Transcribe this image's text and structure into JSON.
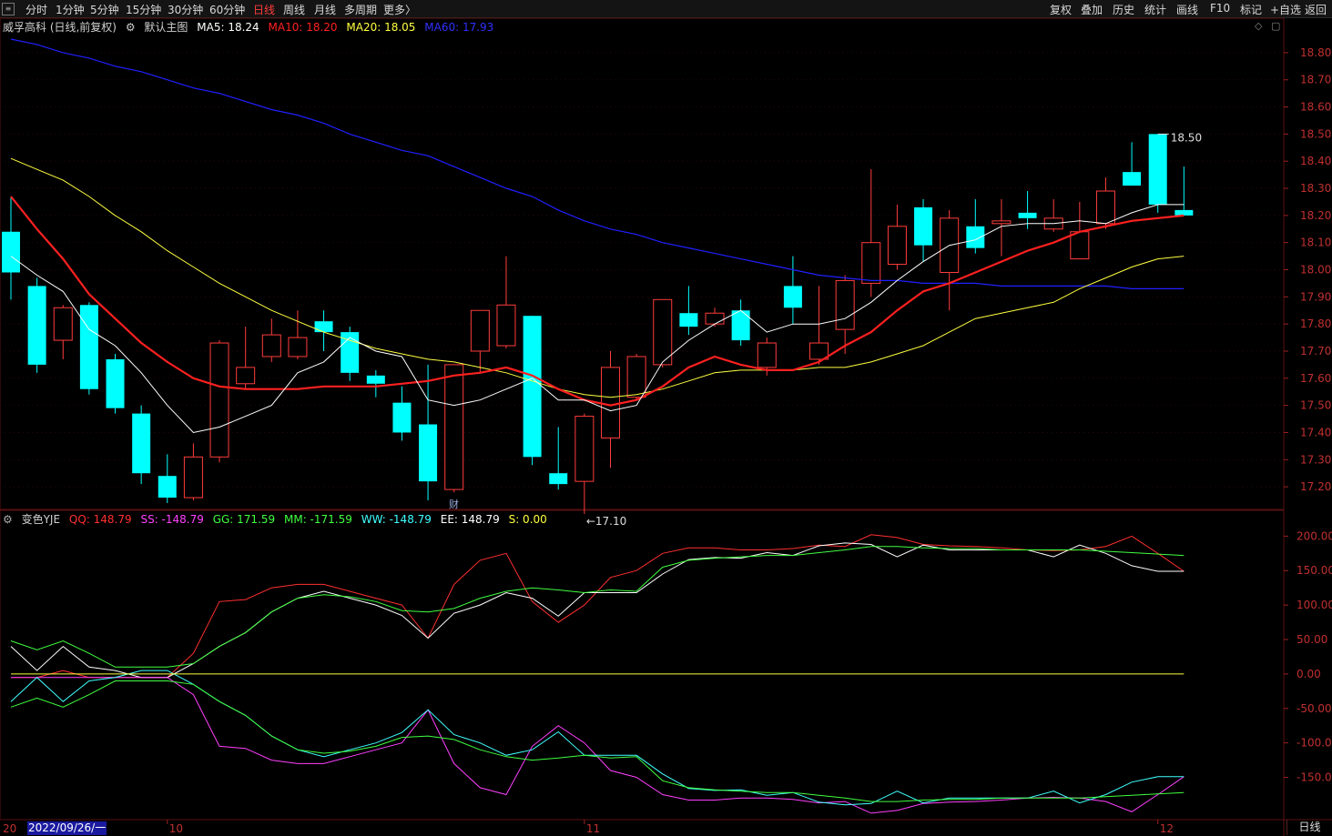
{
  "toolbar": {
    "menu_icon": "menu-icon",
    "periods": [
      "分时",
      "1分钟",
      "5分钟",
      "15分钟",
      "30分钟",
      "60分钟",
      "日线",
      "周线",
      "月线",
      "多周期",
      "更多〉"
    ],
    "active_period": "日线",
    "right_buttons": [
      "复权",
      "叠加",
      "历史",
      "统计",
      "画线",
      "F10",
      "标记",
      "+自选",
      "返回"
    ]
  },
  "main_chart": {
    "stock_name": "威孚高科 (日线,前复权)",
    "template": "默认主图",
    "ma_indicators": [
      {
        "label": "MA5: 18.24",
        "color": "#ffffff"
      },
      {
        "label": "MA10: 18.20",
        "color": "#ff2020"
      },
      {
        "label": "MA20: 18.05",
        "color": "#ffff40"
      },
      {
        "label": "MA60: 17.93",
        "color": "#2020ff"
      }
    ],
    "price_ticks": [
      "18.80",
      "18.70",
      "18.60",
      "18.50",
      "18.40",
      "18.30",
      "18.20",
      "18.10",
      "18.00",
      "17.90",
      "17.80",
      "17.70",
      "17.60",
      "17.50",
      "17.40",
      "17.30",
      "17.20"
    ],
    "high_annotation": "18.50",
    "low_annotation": "←17.10",
    "finance_mark": "财"
  },
  "sub_chart": {
    "indicator_name": "变色YJE",
    "values": [
      {
        "label": "QQ: 148.79",
        "color": "#ff3030"
      },
      {
        "label": "SS: -148.79",
        "color": "#ff40ff"
      },
      {
        "label": "GG: 171.59",
        "color": "#40ff40"
      },
      {
        "label": "MM: -171.59",
        "color": "#40ff40"
      },
      {
        "label": "WW: -148.79",
        "color": "#40ffff"
      },
      {
        "label": "EE: 148.79",
        "color": "#ffffff"
      },
      {
        "label": "S: 0.00",
        "color": "#ffff40"
      }
    ],
    "ticks": [
      "200.00",
      "150.00",
      "100.00",
      "50.00",
      "0.00",
      "-50.00",
      "-100.00",
      "-150.00"
    ]
  },
  "x_axis": {
    "first_label": "20",
    "cursor_date": "2022/09/26/一",
    "month_labels": [
      {
        "idx": 6,
        "label": "10"
      },
      {
        "idx": 22,
        "label": "11"
      },
      {
        "idx": 44,
        "label": "12"
      }
    ]
  },
  "period_label": "日线",
  "colors": {
    "up": "#ff3c3c",
    "down": "#00ffff",
    "ma5": "#ffffff",
    "ma10": "#ff2020",
    "ma20": "#ffff40",
    "ma60": "#2020ff",
    "grid": "#5a1010"
  },
  "chart_data": {
    "type": "candlestick",
    "ohlc": [
      [
        18.14,
        18.27,
        17.89,
        17.99
      ],
      [
        17.94,
        17.97,
        17.62,
        17.65
      ],
      [
        17.74,
        17.87,
        17.67,
        17.86
      ],
      [
        17.87,
        17.88,
        17.54,
        17.56
      ],
      [
        17.67,
        17.69,
        17.47,
        17.49
      ],
      [
        17.47,
        17.5,
        17.21,
        17.25
      ],
      [
        17.24,
        17.32,
        17.14,
        17.16
      ],
      [
        17.16,
        17.36,
        17.15,
        17.31
      ],
      [
        17.31,
        17.74,
        17.29,
        17.73
      ],
      [
        17.58,
        17.79,
        17.56,
        17.64
      ],
      [
        17.68,
        17.82,
        17.66,
        17.76
      ],
      [
        17.68,
        17.85,
        17.67,
        17.75
      ],
      [
        17.81,
        17.85,
        17.7,
        17.77
      ],
      [
        17.77,
        17.79,
        17.59,
        17.62
      ],
      [
        17.61,
        17.63,
        17.53,
        17.58
      ],
      [
        17.51,
        17.57,
        17.37,
        17.4
      ],
      [
        17.43,
        17.65,
        17.15,
        17.22
      ],
      [
        17.19,
        17.65,
        17.18,
        17.65
      ],
      [
        17.7,
        17.84,
        17.62,
        17.85
      ],
      [
        17.72,
        18.05,
        17.71,
        17.87
      ],
      [
        17.83,
        17.83,
        17.28,
        17.31
      ],
      [
        17.25,
        17.42,
        17.19,
        17.21
      ],
      [
        17.22,
        17.47,
        17.1,
        17.46
      ],
      [
        17.38,
        17.7,
        17.27,
        17.64
      ],
      [
        17.53,
        17.69,
        17.52,
        17.68
      ],
      [
        17.65,
        17.88,
        17.64,
        17.89
      ],
      [
        17.84,
        17.94,
        17.76,
        17.79
      ],
      [
        17.8,
        17.86,
        17.79,
        17.84
      ],
      [
        17.85,
        17.89,
        17.72,
        17.74
      ],
      [
        17.64,
        17.75,
        17.61,
        17.73
      ],
      [
        17.94,
        18.05,
        17.8,
        17.86
      ],
      [
        17.67,
        17.94,
        17.65,
        17.73
      ],
      [
        17.78,
        17.98,
        17.69,
        17.96
      ],
      [
        17.95,
        18.37,
        17.9,
        18.1
      ],
      [
        18.02,
        18.24,
        18.0,
        18.16
      ],
      [
        18.23,
        18.26,
        18.03,
        18.09
      ],
      [
        17.99,
        18.22,
        17.85,
        18.19
      ],
      [
        18.16,
        18.26,
        18.06,
        18.08
      ],
      [
        18.17,
        18.26,
        18.05,
        18.18
      ],
      [
        18.21,
        18.29,
        18.15,
        18.19
      ],
      [
        18.15,
        18.26,
        18.14,
        18.19
      ],
      [
        18.04,
        18.25,
        18.13,
        18.14
      ],
      [
        18.17,
        18.34,
        18.15,
        18.29
      ],
      [
        18.36,
        18.47,
        18.33,
        18.31
      ],
      [
        18.5,
        18.5,
        18.21,
        18.24
      ],
      [
        18.22,
        18.38,
        18.2,
        18.2
      ]
    ],
    "ma5": [
      18.05,
      17.98,
      17.92,
      17.78,
      17.72,
      17.62,
      17.5,
      17.4,
      17.42,
      17.46,
      17.5,
      17.62,
      17.66,
      17.75,
      17.7,
      17.68,
      17.52,
      17.5,
      17.52,
      17.56,
      17.6,
      17.52,
      17.52,
      17.48,
      17.5,
      17.66,
      17.74,
      17.8,
      17.85,
      17.77,
      17.8,
      17.8,
      17.82,
      17.88,
      17.96,
      18.03,
      18.09,
      18.11,
      18.16,
      18.17,
      18.17,
      18.18,
      18.17,
      18.21,
      18.24,
      18.24
    ],
    "ma10": [
      18.27,
      18.15,
      18.04,
      17.91,
      17.82,
      17.73,
      17.66,
      17.6,
      17.57,
      17.56,
      17.56,
      17.56,
      17.57,
      17.57,
      17.57,
      17.58,
      17.59,
      17.61,
      17.62,
      17.64,
      17.61,
      17.56,
      17.52,
      17.5,
      17.52,
      17.57,
      17.64,
      17.68,
      17.65,
      17.63,
      17.63,
      17.66,
      17.72,
      17.77,
      17.85,
      17.92,
      17.95,
      17.99,
      18.03,
      18.07,
      18.1,
      18.14,
      18.16,
      18.18,
      18.19,
      18.2
    ],
    "ma20": [
      18.41,
      18.37,
      18.33,
      18.27,
      18.2,
      18.14,
      18.07,
      18.01,
      17.95,
      17.9,
      17.85,
      17.81,
      17.77,
      17.74,
      17.71,
      17.69,
      17.67,
      17.66,
      17.64,
      17.62,
      17.59,
      17.56,
      17.54,
      17.53,
      17.54,
      17.56,
      17.59,
      17.62,
      17.63,
      17.63,
      17.63,
      17.64,
      17.64,
      17.66,
      17.69,
      17.72,
      17.77,
      17.82,
      17.84,
      17.86,
      17.88,
      17.93,
      17.97,
      18.01,
      18.04,
      18.05
    ],
    "ma60": [
      18.85,
      18.83,
      18.8,
      18.78,
      18.75,
      18.73,
      18.7,
      18.67,
      18.65,
      18.62,
      18.59,
      18.57,
      18.54,
      18.5,
      18.47,
      18.44,
      18.42,
      18.38,
      18.34,
      18.3,
      18.27,
      18.22,
      18.18,
      18.15,
      18.13,
      18.1,
      18.08,
      18.06,
      18.04,
      18.02,
      18.0,
      17.98,
      17.97,
      17.96,
      17.96,
      17.95,
      17.95,
      17.95,
      17.94,
      17.94,
      17.94,
      17.94,
      17.94,
      17.93,
      17.93,
      17.93
    ],
    "price_range": [
      17.13,
      18.86
    ],
    "sub_range": [
      -210,
      215
    ],
    "sub_series": [
      {
        "key": "QQ",
        "color": "#ff3030",
        "values": [
          -5,
          -5,
          5,
          -5,
          -5,
          -5,
          -5,
          30,
          105,
          108,
          125,
          130,
          130,
          120,
          110,
          100,
          52,
          130,
          165,
          175,
          105,
          75,
          100,
          140,
          150,
          175,
          183,
          183,
          180,
          180,
          182,
          187,
          185,
          202,
          198,
          188,
          186,
          185,
          183,
          180,
          179,
          180,
          185,
          200,
          175,
          149
        ]
      },
      {
        "key": "EE",
        "color": "#ffffff",
        "values": [
          40,
          5,
          40,
          10,
          5,
          -5,
          -5,
          15,
          40,
          60,
          90,
          110,
          120,
          110,
          100,
          85,
          52,
          88,
          100,
          118,
          110,
          84,
          118,
          118,
          118,
          145,
          166,
          169,
          168,
          176,
          172,
          186,
          190,
          188,
          170,
          187,
          180,
          180,
          180,
          180,
          170,
          187,
          175,
          157,
          149,
          149
        ]
      },
      {
        "key": "GG",
        "color": "#40ff40",
        "values": [
          48,
          35,
          48,
          30,
          10,
          10,
          10,
          15,
          40,
          60,
          90,
          110,
          115,
          112,
          105,
          92,
          90,
          95,
          110,
          120,
          125,
          122,
          118,
          122,
          120,
          155,
          165,
          168,
          170,
          172,
          172,
          176,
          180,
          185,
          185,
          183,
          182,
          182,
          180,
          180,
          180,
          180,
          178,
          176,
          174,
          172
        ]
      },
      {
        "key": "SS",
        "color": "#ff40ff",
        "values": [
          -5,
          -5,
          -5,
          -5,
          -5,
          -5,
          -5,
          -30,
          -105,
          -108,
          -125,
          -130,
          -130,
          -120,
          -110,
          -100,
          -52,
          -130,
          -165,
          -175,
          -105,
          -75,
          -100,
          -140,
          -150,
          -175,
          -183,
          -183,
          -180,
          -180,
          -182,
          -187,
          -185,
          -202,
          -198,
          -188,
          -186,
          -185,
          -183,
          -180,
          -179,
          -180,
          -185,
          -200,
          -175,
          -149
        ]
      },
      {
        "key": "WW",
        "color": "#40ffff",
        "values": [
          -40,
          -5,
          -40,
          -10,
          -5,
          5,
          5,
          -15,
          -40,
          -60,
          -90,
          -110,
          -120,
          -110,
          -100,
          -85,
          -52,
          -88,
          -100,
          -118,
          -110,
          -84,
          -118,
          -118,
          -118,
          -145,
          -166,
          -169,
          -168,
          -176,
          -172,
          -186,
          -190,
          -188,
          -170,
          -187,
          -180,
          -180,
          -180,
          -180,
          -170,
          -187,
          -175,
          -157,
          -149,
          -149
        ]
      },
      {
        "key": "MM",
        "color": "#40ff40",
        "values": [
          -48,
          -35,
          -48,
          -30,
          -10,
          -10,
          -10,
          -15,
          -40,
          -60,
          -90,
          -110,
          -115,
          -112,
          -105,
          -92,
          -90,
          -95,
          -110,
          -120,
          -125,
          -122,
          -118,
          -122,
          -120,
          -155,
          -165,
          -168,
          -170,
          -172,
          -172,
          -176,
          -180,
          -185,
          -185,
          -183,
          -182,
          -182,
          -180,
          -180,
          -180,
          -180,
          -178,
          -176,
          -174,
          -172
        ]
      },
      {
        "key": "S",
        "color": "#ffff40",
        "values": [
          0,
          0,
          0,
          0,
          0,
          0,
          0,
          0,
          0,
          0,
          0,
          0,
          0,
          0,
          0,
          0,
          0,
          0,
          0,
          0,
          0,
          0,
          0,
          0,
          0,
          0,
          0,
          0,
          0,
          0,
          0,
          0,
          0,
          0,
          0,
          0,
          0,
          0,
          0,
          0,
          0,
          0,
          0,
          0,
          0,
          0
        ]
      }
    ]
  }
}
